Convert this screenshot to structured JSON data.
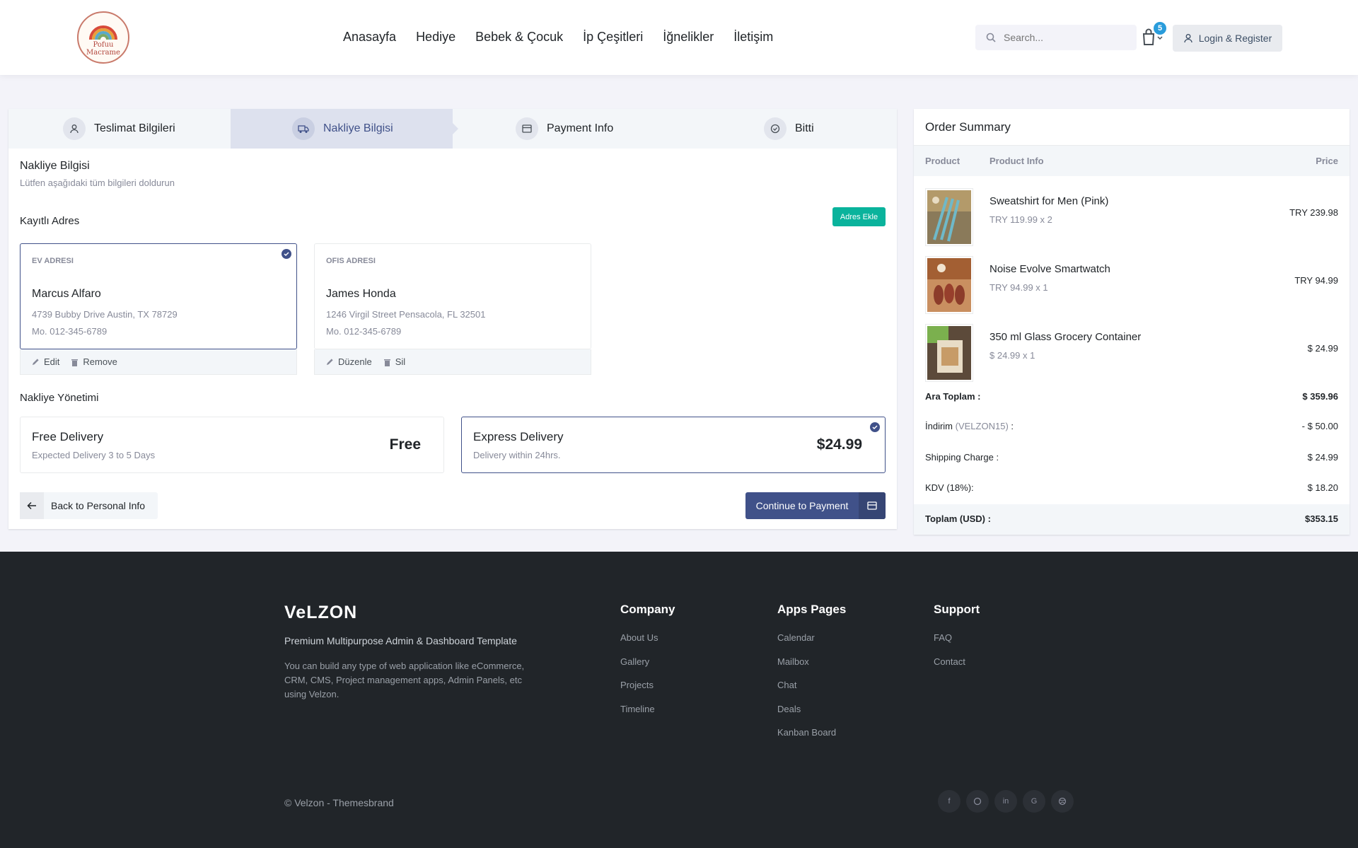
{
  "header": {
    "logo_line1": "Pofuu",
    "logo_line2": "Macrame",
    "nav": [
      "Anasayfa",
      "Hediye",
      "Bebek & Çocuk",
      "İp Çeşitleri",
      "İğnelikler",
      "İletişim"
    ],
    "search_placeholder": "Search...",
    "cart_count": "5",
    "login_label": "Login & Register"
  },
  "steps": [
    {
      "label": "Teslimat Bilgileri",
      "icon": "user-icon"
    },
    {
      "label": "Nakliye Bilgisi",
      "icon": "truck-icon",
      "active": true
    },
    {
      "label": "Payment Info",
      "icon": "card-icon"
    },
    {
      "label": "Bitti",
      "icon": "check-circle-icon"
    }
  ],
  "shipping_info": {
    "title": "Nakliye Bilgisi",
    "subtitle": "Lütfen aşağıdaki tüm bilgileri doldurun",
    "saved_address_title": "Kayıtlı Adres",
    "add_address_label": "Adres Ekle",
    "addresses": [
      {
        "tag": "EV ADRESI",
        "name": "Marcus Alfaro",
        "street": "4739 Bubby Drive Austin, TX 78729",
        "phone": "Mo. 012-345-6789",
        "edit": "Edit",
        "remove": "Remove",
        "selected": true
      },
      {
        "tag": "OFIS ADRESI",
        "name": "James Honda",
        "street": "1246 Virgil Street Pensacola, FL 32501",
        "phone": "Mo. 012-345-6789",
        "edit": "Düzenle",
        "remove": "Sil",
        "selected": false
      }
    ],
    "delivery_title": "Nakliye Yönetimi",
    "delivery_options": [
      {
        "title": "Free Delivery",
        "desc": "Expected Delivery 3 to 5 Days",
        "price": "Free",
        "selected": false
      },
      {
        "title": "Express Delivery",
        "desc": "Delivery within 24hrs.",
        "price": "$24.99",
        "selected": true
      }
    ],
    "back_label": "Back to Personal Info",
    "continue_label": "Continue to Payment"
  },
  "summary": {
    "title": "Order Summary",
    "columns": [
      "Product",
      "Product Info",
      "Price"
    ],
    "products": [
      {
        "name": "Sweatshirt for Men (Pink)",
        "qty": "TRY 119.99 x 2",
        "price": "TRY 239.98"
      },
      {
        "name": "Noise Evolve Smartwatch",
        "qty": "TRY 94.99 x 1",
        "price": "TRY 94.99"
      },
      {
        "name": "350 ml Glass Grocery Container",
        "qty": "$ 24.99 x 1",
        "price": "$ 24.99"
      }
    ],
    "subtotal_label": "Ara Toplam :",
    "subtotal_value": "$ 359.96",
    "discount_label": "İndirim",
    "discount_code": "(VELZON15)",
    "discount_colon": ":",
    "discount_value": "- $ 50.00",
    "shipping_label": "Shipping Charge :",
    "shipping_value": "$ 24.99",
    "tax_label": "KDV (18%):",
    "tax_value": "$ 18.20",
    "total_label": "Toplam (USD) :",
    "total_value": "$353.15"
  },
  "footer": {
    "brand": "VeLZON",
    "tagline": "Premium Multipurpose Admin & Dashboard Template",
    "description": "You can build any type of web application like eCommerce, CRM, CMS, Project management apps, Admin Panels, etc using Velzon.",
    "columns": [
      {
        "title": "Company",
        "links": [
          "About Us",
          "Gallery",
          "Projects",
          "Timeline"
        ]
      },
      {
        "title": "Apps Pages",
        "links": [
          "Calendar",
          "Mailbox",
          "Chat",
          "Deals",
          "Kanban Board"
        ]
      },
      {
        "title": "Support",
        "links": [
          "FAQ",
          "Contact"
        ]
      }
    ],
    "copyright": "© Velzon - Themesbrand",
    "socials": [
      "facebook-icon",
      "github-icon",
      "linkedin-icon",
      "google-icon",
      "dribbble-icon"
    ]
  }
}
